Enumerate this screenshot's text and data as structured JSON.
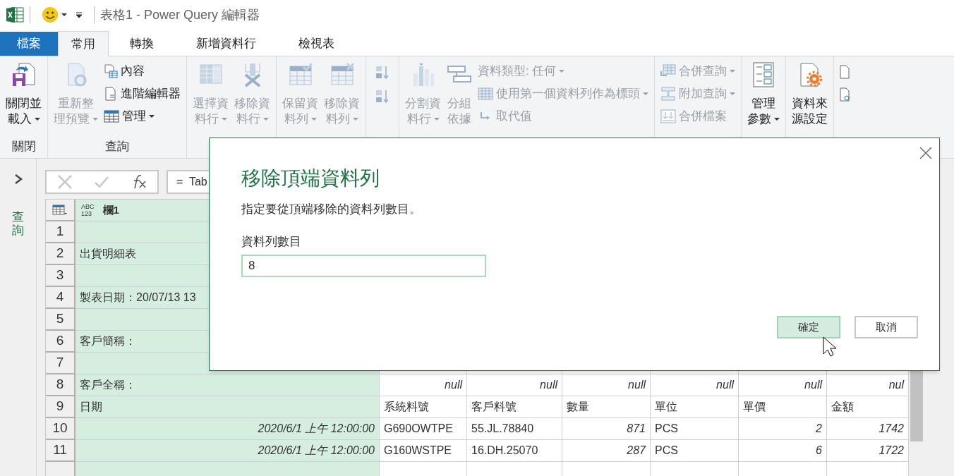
{
  "title_bar": {
    "title": "表格1 - Power Query 編輯器"
  },
  "file_tab": {
    "label": "檔案"
  },
  "tabs": [
    {
      "label": "常用",
      "selected": true
    },
    {
      "label": "轉換",
      "selected": false
    },
    {
      "label": "新增資料行",
      "selected": false
    },
    {
      "label": "檢視表",
      "selected": false
    }
  ],
  "ribbon": {
    "groups": [
      {
        "label": "關閉",
        "items": [
          {
            "kind": "large",
            "lines": [
              "關閉並",
              "載入"
            ],
            "dropdown": true,
            "disabled": false
          }
        ]
      },
      {
        "label": "查詢",
        "items": [
          {
            "kind": "large",
            "lines": [
              "重新整",
              "理預覽"
            ],
            "dropdown": true,
            "disabled": true
          },
          {
            "kind": "stack",
            "items": [
              {
                "label": "內容",
                "dropdown": false,
                "disabled": false
              },
              {
                "label": "進階編輯器",
                "dropdown": false,
                "disabled": false
              },
              {
                "label": "管理",
                "dropdown": true,
                "disabled": false
              }
            ]
          }
        ]
      },
      {
        "items": [
          {
            "kind": "large",
            "lines": [
              "選擇資",
              "料行"
            ],
            "dropdown": true,
            "disabled": true
          },
          {
            "kind": "large",
            "lines": [
              "移除資",
              "料行"
            ],
            "dropdown": true,
            "disabled": true
          }
        ]
      },
      {
        "items": [
          {
            "kind": "large",
            "lines": [
              "保留資",
              "料列"
            ],
            "dropdown": true,
            "disabled": true
          },
          {
            "kind": "large",
            "lines": [
              "移除資",
              "料列"
            ],
            "dropdown": true,
            "disabled": true
          }
        ]
      },
      {
        "items": [
          {
            "kind": "icons",
            "count_disabled": [
              true,
              true
            ]
          }
        ]
      },
      {
        "items": [
          {
            "kind": "large",
            "lines": [
              "分割資",
              "料行"
            ],
            "dropdown": true,
            "disabled": true
          },
          {
            "kind": "large",
            "lines": [
              "分組",
              "依據"
            ],
            "dropdown": false,
            "disabled": true
          },
          {
            "kind": "stack",
            "items": [
              {
                "label": "資料類型: 任何",
                "dropdown": true,
                "disabled": true
              },
              {
                "label": "使用第一個資料列作為標頭",
                "dropdown": true,
                "disabled": true
              },
              {
                "label": "取代值",
                "dropdown": false,
                "disabled": true
              }
            ]
          }
        ]
      },
      {
        "items": [
          {
            "kind": "stack",
            "items": [
              {
                "label": "合併查詢",
                "dropdown": true,
                "disabled": true
              },
              {
                "label": "附加查詢",
                "dropdown": true,
                "disabled": true
              },
              {
                "label": "合併檔案",
                "dropdown": false,
                "disabled": true
              }
            ]
          }
        ]
      },
      {
        "items": [
          {
            "kind": "large",
            "lines": [
              "管理",
              "參數"
            ],
            "dropdown": true,
            "disabled": false
          }
        ]
      },
      {
        "items": [
          {
            "kind": "large",
            "lines": [
              "資料來",
              "源設定"
            ],
            "dropdown": false,
            "disabled": false
          }
        ]
      }
    ]
  },
  "queries_pane": {
    "label": "查詢",
    "expanded": false
  },
  "formula_bar": {
    "formula": "=  Tab"
  },
  "grid": {
    "column_1_header": "欄1",
    "column_1_type": [
      "ABC",
      "123"
    ],
    "rows": [
      {
        "number": "1",
        "cells": [
          null,
          null,
          null,
          null,
          null,
          null,
          null
        ]
      },
      {
        "number": "2",
        "cells": [
          {
            "text": "出貨明細表",
            "kind": "text"
          },
          null,
          null,
          null,
          null,
          null,
          null
        ]
      },
      {
        "number": "3",
        "cells": [
          null,
          null,
          null,
          null,
          null,
          null,
          null
        ]
      },
      {
        "number": "4",
        "cells": [
          {
            "text": "製表日期：20/07/13 13",
            "kind": "text"
          },
          null,
          null,
          null,
          null,
          null,
          null
        ]
      },
      {
        "number": "5",
        "cells": [
          null,
          null,
          null,
          null,
          null,
          null,
          null
        ]
      },
      {
        "number": "6",
        "cells": [
          {
            "text": "客戶簡稱：",
            "kind": "text"
          },
          null,
          null,
          null,
          null,
          null,
          null
        ]
      },
      {
        "number": "7",
        "cells": [
          null,
          null,
          null,
          null,
          null,
          null,
          null
        ]
      },
      {
        "number": "8",
        "cells": [
          {
            "text": "客戶全稱：",
            "kind": "text"
          },
          {
            "text": "null",
            "kind": "value"
          },
          {
            "text": "null",
            "kind": "value"
          },
          {
            "text": "null",
            "kind": "value"
          },
          {
            "text": "null",
            "kind": "value"
          },
          {
            "text": "null",
            "kind": "value"
          },
          {
            "text": "nul",
            "kind": "value"
          }
        ]
      },
      {
        "number": "9",
        "cells": [
          {
            "text": "日期",
            "kind": "text"
          },
          {
            "text": "系統料號",
            "kind": "text"
          },
          {
            "text": "客戶料號",
            "kind": "text"
          },
          {
            "text": "數量",
            "kind": "text"
          },
          {
            "text": "單位",
            "kind": "text"
          },
          {
            "text": "單價",
            "kind": "text"
          },
          {
            "text": "金額",
            "kind": "text"
          }
        ]
      },
      {
        "number": "10",
        "cells": [
          {
            "text": "2020/6/1 上午 12:00:00",
            "kind": "value"
          },
          {
            "text": "G690OWTPE",
            "kind": "text"
          },
          {
            "text": "55.JL.78840",
            "kind": "text"
          },
          {
            "text": "871",
            "kind": "value"
          },
          {
            "text": "PCS",
            "kind": "text"
          },
          {
            "text": "2",
            "kind": "value"
          },
          {
            "text": "1742",
            "kind": "value"
          }
        ]
      },
      {
        "number": "11",
        "cells": [
          {
            "text": "2020/6/1 上午 12:00:00",
            "kind": "value"
          },
          {
            "text": "G160WSTPE",
            "kind": "text"
          },
          {
            "text": "16.DH.25070",
            "kind": "text"
          },
          {
            "text": "287",
            "kind": "value"
          },
          {
            "text": "PCS",
            "kind": "text"
          },
          {
            "text": "6",
            "kind": "value"
          },
          {
            "text": "1722",
            "kind": "value"
          }
        ]
      }
    ]
  },
  "dialog": {
    "title": "移除頂端資料列",
    "description": "指定要從頂端移除的資料列數目。",
    "field_label": "資料列數目",
    "field_value": "8",
    "buttons": [
      {
        "label": "確定",
        "selected": true
      },
      {
        "label": "取消",
        "selected": false
      }
    ]
  }
}
